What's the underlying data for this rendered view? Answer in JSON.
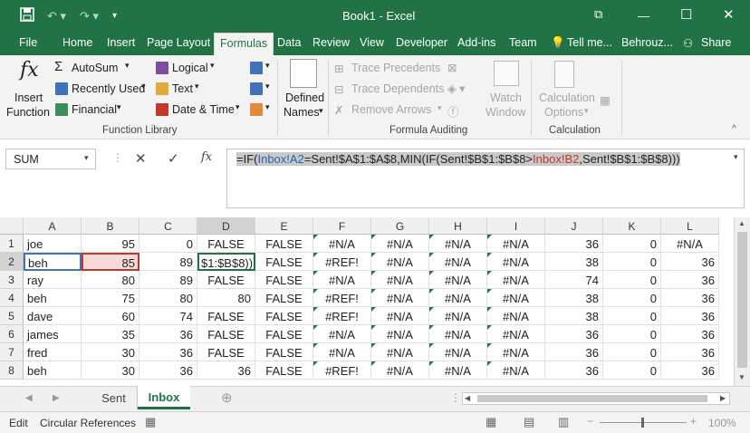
{
  "window": {
    "title": "Book1 - Excel"
  },
  "ribbon_tabs": [
    "File",
    "Home",
    "Insert",
    "Page Layout",
    "Formulas",
    "Data",
    "Review",
    "View",
    "Developer",
    "Add-ins",
    "Team"
  ],
  "tell_me": "Tell me...",
  "user": "Behrouz...",
  "share": "Share",
  "function_library": {
    "insert_function": [
      "Insert",
      "Function"
    ],
    "autosum": "AutoSum",
    "recently_used": "Recently Used",
    "financial": "Financial",
    "logical": "Logical",
    "text": "Text",
    "date_time": "Date & Time",
    "group_label": "Function Library"
  },
  "defined_names": {
    "label": [
      "Defined",
      "Names"
    ]
  },
  "formula_auditing": {
    "trace_precedents": "Trace Precedents",
    "trace_dependents": "Trace Dependents",
    "remove_arrows": "Remove Arrows",
    "watch_window": [
      "Watch",
      "Window"
    ],
    "group_label": "Formula Auditing"
  },
  "calculation": {
    "options": [
      "Calculation",
      "Options"
    ],
    "group_label": "Calculation"
  },
  "name_box": "SUM",
  "formula_bar": {
    "segments": [
      {
        "text": "=IF(",
        "color": "#222222"
      },
      {
        "text": "Inbox!A2",
        "color": "#2f5fb3"
      },
      {
        "text": "=Sent!$A$1:$A$8,MIN(IF(Sent!$B$1:$B$8>",
        "color": "#222222"
      },
      {
        "text": "Inbox!B2",
        "color": "#c0392b"
      },
      {
        "text": ",Sent!$B$1:$B$8)))",
        "color": "#222222"
      }
    ]
  },
  "columns": [
    "A",
    "B",
    "C",
    "D",
    "E",
    "F",
    "G",
    "H",
    "I",
    "J",
    "K",
    "L"
  ],
  "rows": [
    [
      "joe",
      "95",
      "0",
      "FALSE",
      "FALSE",
      "#N/A",
      "#N/A",
      "#N/A",
      "#N/A",
      "36",
      "0",
      "#N/A"
    ],
    [
      "beh",
      "85",
      "89",
      "$1:$B$8)))",
      "FALSE",
      "#REF!",
      "#N/A",
      "#N/A",
      "#N/A",
      "38",
      "0",
      "36"
    ],
    [
      "ray",
      "80",
      "89",
      "FALSE",
      "FALSE",
      "#N/A",
      "#N/A",
      "#N/A",
      "#N/A",
      "74",
      "0",
      "36"
    ],
    [
      "beh",
      "75",
      "80",
      "80",
      "FALSE",
      "#REF!",
      "#N/A",
      "#N/A",
      "#N/A",
      "38",
      "0",
      "36"
    ],
    [
      "dave",
      "60",
      "74",
      "FALSE",
      "FALSE",
      "#REF!",
      "#N/A",
      "#N/A",
      "#N/A",
      "38",
      "0",
      "36"
    ],
    [
      "james",
      "35",
      "36",
      "FALSE",
      "FALSE",
      "#N/A",
      "#N/A",
      "#N/A",
      "#N/A",
      "36",
      "0",
      "36"
    ],
    [
      "fred",
      "30",
      "36",
      "FALSE",
      "FALSE",
      "#N/A",
      "#N/A",
      "#N/A",
      "#N/A",
      "36",
      "0",
      "36"
    ],
    [
      "beh",
      "30",
      "36",
      "36",
      "FALSE",
      "#REF!",
      "#N/A",
      "#N/A",
      "#N/A",
      "36",
      "0",
      "36"
    ]
  ],
  "sheet_tabs": [
    "Sent",
    "Inbox"
  ],
  "active_sheet": "Inbox",
  "status": {
    "mode": "Edit",
    "circular": "Circular References",
    "zoom": "100%"
  }
}
